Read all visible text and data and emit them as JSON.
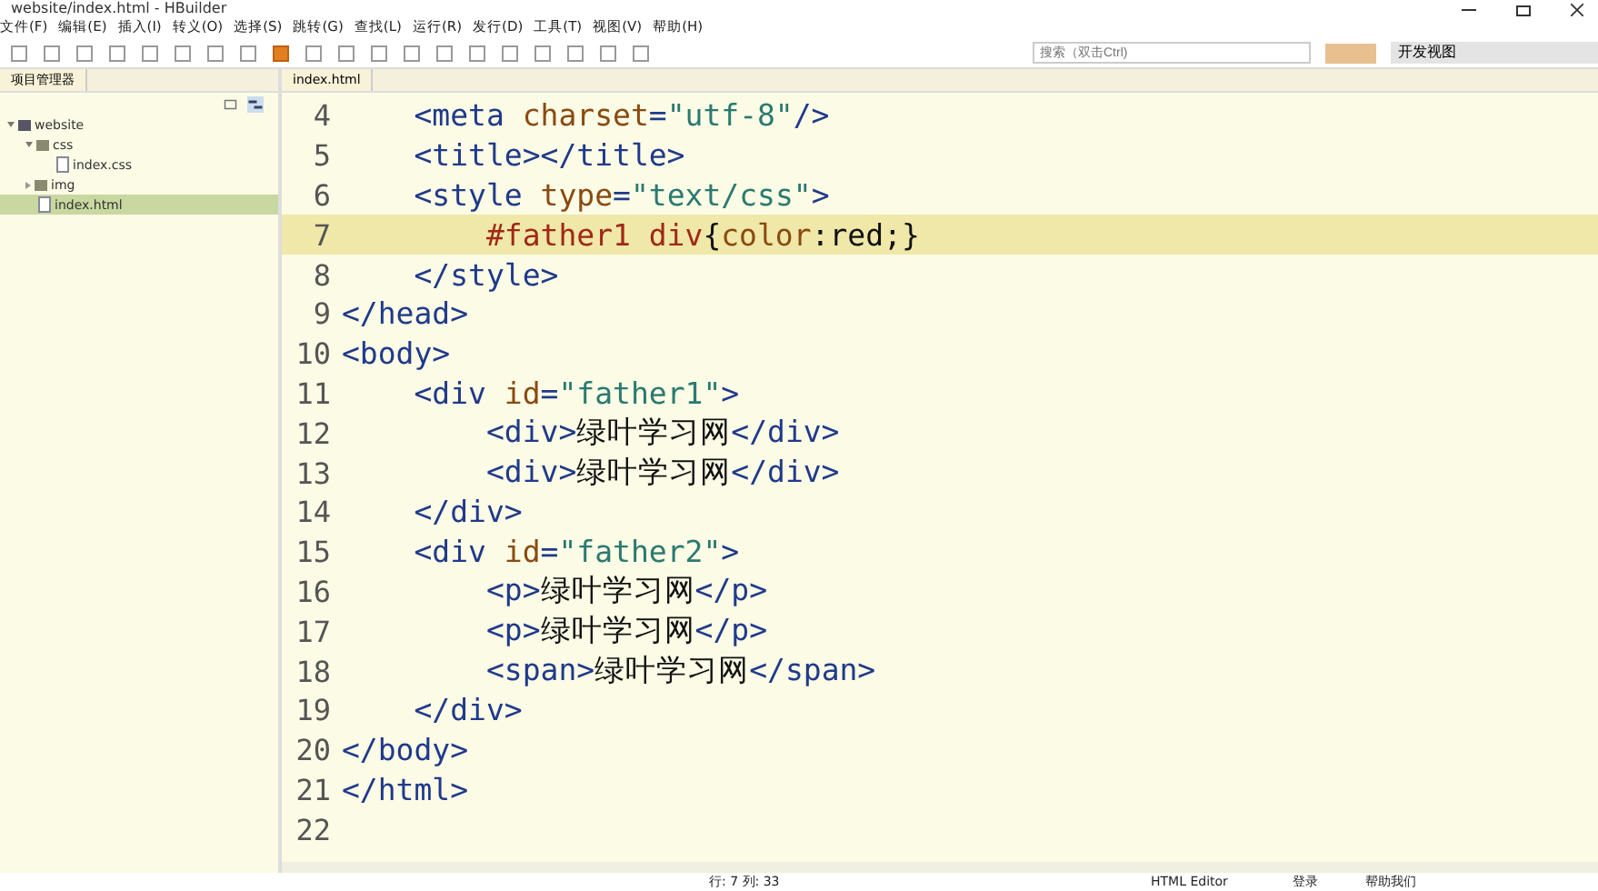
{
  "window": {
    "title": "website/index.html - HBuilder"
  },
  "menu": [
    "文件(F)",
    "编辑(E)",
    "插入(I)",
    "转义(O)",
    "选择(S)",
    "跳转(G)",
    "查找(L)",
    "运行(R)",
    "发行(D)",
    "工具(T)",
    "视图(V)",
    "帮助(H)"
  ],
  "search": {
    "placeholder": "搜索（双击Ctrl)"
  },
  "perspective": {
    "value": "开发视图"
  },
  "sidebar": {
    "title": "项目管理器",
    "tree": [
      {
        "label": "website",
        "kind": "project",
        "expanded": true,
        "selected": false,
        "children": [
          {
            "label": "css",
            "kind": "folder",
            "expanded": true,
            "selected": false,
            "children": [
              {
                "label": "index.css",
                "kind": "file",
                "selected": false
              }
            ]
          },
          {
            "label": "img",
            "kind": "folder",
            "expanded": false,
            "selected": false
          },
          {
            "label": "index.html",
            "kind": "file",
            "selected": true
          }
        ]
      }
    ]
  },
  "editor": {
    "tab": "index.html",
    "lines": [
      {
        "number": "4",
        "current": false,
        "tokens": [
          {
            "kind": "tag",
            "text": "    <meta "
          },
          {
            "kind": "attr",
            "text": "charset"
          },
          {
            "kind": "tag",
            "text": "="
          },
          {
            "kind": "str",
            "text": "\"utf-8\""
          },
          {
            "kind": "tag",
            "text": "/>"
          }
        ]
      },
      {
        "number": "5",
        "current": false,
        "tokens": [
          {
            "kind": "tag",
            "text": "    <title></title>"
          }
        ]
      },
      {
        "number": "6",
        "current": false,
        "tokens": [
          {
            "kind": "tag",
            "text": "    <style "
          },
          {
            "kind": "attr",
            "text": "type"
          },
          {
            "kind": "tag",
            "text": "="
          },
          {
            "kind": "str",
            "text": "\"text/css\""
          },
          {
            "kind": "tag",
            "text": ">"
          }
        ]
      },
      {
        "number": "7",
        "current": true,
        "tokens": [
          {
            "kind": "sel",
            "text": "        #father1 div"
          },
          {
            "kind": "text",
            "text": "{"
          },
          {
            "kind": "attr",
            "text": "color"
          },
          {
            "kind": "text",
            "text": ":red;}"
          }
        ]
      },
      {
        "number": "8",
        "current": false,
        "tokens": [
          {
            "kind": "tag",
            "text": "    </style>"
          }
        ]
      },
      {
        "number": "9",
        "current": false,
        "tokens": [
          {
            "kind": "tag",
            "text": "</head>"
          }
        ]
      },
      {
        "number": "10",
        "current": false,
        "tokens": [
          {
            "kind": "tag",
            "text": "<body>"
          }
        ]
      },
      {
        "number": "11",
        "current": false,
        "tokens": [
          {
            "kind": "tag",
            "text": "    <div "
          },
          {
            "kind": "attr",
            "text": "id"
          },
          {
            "kind": "tag",
            "text": "="
          },
          {
            "kind": "str",
            "text": "\"father1\""
          },
          {
            "kind": "tag",
            "text": ">"
          }
        ]
      },
      {
        "number": "12",
        "current": false,
        "tokens": [
          {
            "kind": "tag",
            "text": "        <div>"
          },
          {
            "kind": "text",
            "text": "绿叶学习网"
          },
          {
            "kind": "tag",
            "text": "</div>"
          }
        ]
      },
      {
        "number": "13",
        "current": false,
        "tokens": [
          {
            "kind": "tag",
            "text": "        <div>"
          },
          {
            "kind": "text",
            "text": "绿叶学习网"
          },
          {
            "kind": "tag",
            "text": "</div>"
          }
        ]
      },
      {
        "number": "14",
        "current": false,
        "tokens": [
          {
            "kind": "tag",
            "text": "    </div>"
          }
        ]
      },
      {
        "number": "15",
        "current": false,
        "tokens": [
          {
            "kind": "tag",
            "text": "    <div "
          },
          {
            "kind": "attr",
            "text": "id"
          },
          {
            "kind": "tag",
            "text": "="
          },
          {
            "kind": "str",
            "text": "\"father2\""
          },
          {
            "kind": "tag",
            "text": ">"
          }
        ]
      },
      {
        "number": "16",
        "current": false,
        "tokens": [
          {
            "kind": "tag",
            "text": "        <p>"
          },
          {
            "kind": "text",
            "text": "绿叶学习网"
          },
          {
            "kind": "tag",
            "text": "</p>"
          }
        ]
      },
      {
        "number": "17",
        "current": false,
        "tokens": [
          {
            "kind": "tag",
            "text": "        <p>"
          },
          {
            "kind": "text",
            "text": "绿叶学习网"
          },
          {
            "kind": "tag",
            "text": "</p>"
          }
        ]
      },
      {
        "number": "18",
        "current": false,
        "tokens": [
          {
            "kind": "tag",
            "text": "        <span>"
          },
          {
            "kind": "text",
            "text": "绿叶学习网"
          },
          {
            "kind": "tag",
            "text": "</span>"
          }
        ]
      },
      {
        "number": "19",
        "current": false,
        "tokens": [
          {
            "kind": "tag",
            "text": "    </div>"
          }
        ]
      },
      {
        "number": "20",
        "current": false,
        "tokens": [
          {
            "kind": "tag",
            "text": "</body>"
          }
        ]
      },
      {
        "number": "21",
        "current": false,
        "tokens": [
          {
            "kind": "tag",
            "text": "</html>"
          }
        ]
      },
      {
        "number": "22",
        "current": false
      }
    ]
  },
  "status_bar": {
    "position": "行: 7 列: 33",
    "mode": "HTML Editor",
    "login": "登录",
    "help": "帮助我们"
  }
}
